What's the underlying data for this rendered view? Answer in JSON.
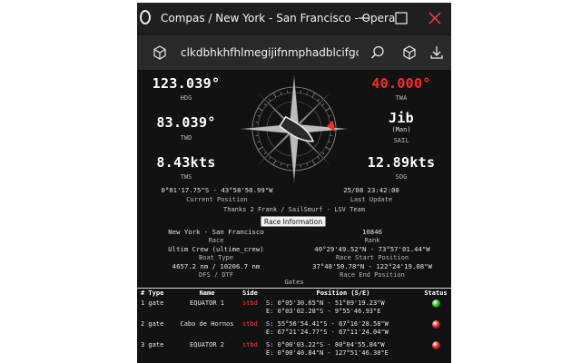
{
  "window": {
    "title": "Compas / New York - San Francisco - Opera",
    "url": "clkdbhkhfhlmegijifnmphadblcifgcc/compas.html"
  },
  "readings": {
    "hdg": {
      "value": "123.039°",
      "label": "HDG"
    },
    "twa": {
      "value": "40.000°",
      "label": "TWA"
    },
    "twd": {
      "value": "83.039°",
      "label": "TWD"
    },
    "sail": {
      "value": "Jib",
      "sub": "(Man)",
      "label": "SAIL"
    },
    "tws": {
      "value": "8.43kts",
      "label": "TWS"
    },
    "sog": {
      "value": "12.89kts",
      "label": "SOG"
    }
  },
  "position": {
    "value": "0°01'17.75\"S - 43°58'50.99\"W",
    "label": "Current Position"
  },
  "update": {
    "value": "25/08 23:42:00",
    "label": "Last Update"
  },
  "thanks": "Thanks 2 Frank / SailSmurf - LSV Team",
  "race_button": "Race Information",
  "race": {
    "name": "New York - San Francisco",
    "name_label": "Race",
    "rank": "10846",
    "rank_label": "Rank",
    "boat": "Ultim Crew (ultime_crew)",
    "boat_label": "Boat Type",
    "start": "40°29'49.52\"N - 73°57'01.44\"W",
    "start_label": "Race Start Position",
    "dfs": "4657.2 nm / 10206.7 nm",
    "dfs_label": "DFS / DTF",
    "end": "37°48'50.78\"N - 122°24'19.08\"W",
    "end_label": "Race End Position"
  },
  "gates": {
    "title": "Gates",
    "headers": [
      "# Type",
      "Name",
      "Side",
      "Position (S/E)",
      "Status"
    ],
    "rows": [
      {
        "num_type": "1 gate",
        "name": "EQUATOR 1",
        "side": "stbd",
        "pos_s": "S: 0°05'30.65\"N - 51°09'19.23\"W",
        "pos_e": "E: 0°03'02.28\"S - 9°55'46.93\"E",
        "status": "green"
      },
      {
        "num_type": "2 gate",
        "name": "Cabo de Hornos",
        "side": "stbd",
        "pos_s": "S: 55°56'54.41\"S - 67°16'28.58\"W",
        "pos_e": "E: 67°21'24.77\"S - 67°11'24.04\"W",
        "status": "red"
      },
      {
        "num_type": "3 gate",
        "name": "EQUATOR 2",
        "side": "stbd",
        "pos_s": "S: 0°00'03.22\"S - 80°04'55.84\"W",
        "pos_e": "E: 0°00'40.84\"N - 127°51'46.30\"E",
        "status": "red"
      }
    ]
  },
  "colors": {
    "status_green": "#27c227",
    "status_red": "#e0281e",
    "accent_red": "#ff2a2a"
  }
}
